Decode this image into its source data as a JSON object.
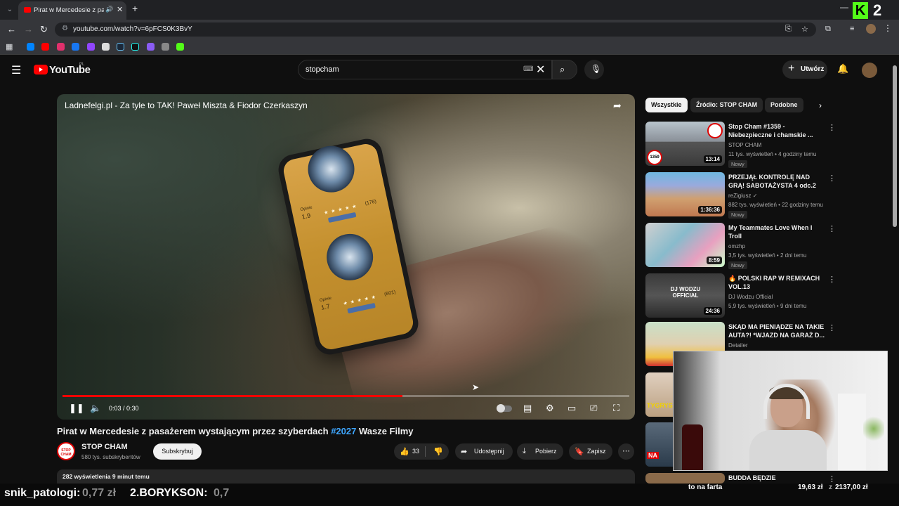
{
  "browser": {
    "tab_title": "Pirat w Mercedesie z pasaż",
    "url": "youtube.com/watch?v=6pFCS0K3BvY",
    "overlay_number": "2"
  },
  "youtube": {
    "logo_text": "YouTube",
    "country_code": "PL",
    "search_value": "stopcham",
    "create_label": "Utwórz"
  },
  "player": {
    "title": "Ladnefelgi.pl - Za tyle to TAK! Paweł Miszta & Fiodor Czerkaszyn",
    "time": "0:03 / 0:30",
    "progress": 0.6,
    "buffered": 0.6,
    "phone": {
      "rating_label": "Opinie",
      "rating_1": "1.9",
      "count_1": "(178)",
      "rating_2": "1.7",
      "count_2": "(601)",
      "stars": "★ ★ ★ ★ ★"
    }
  },
  "video": {
    "title_text": "Pirat w Mercedesie z pasażerem wystającym przez szyberdach ",
    "hashtag": "#2027",
    "title_suffix": " Wasze Filmy",
    "channel_name": "STOP CHAM",
    "channel_avatar_text": "STOP CHAM",
    "subscribers": "580 tys. subskrybentów",
    "subscribe_label": "Subskrybuj",
    "likes": "33",
    "share_label": "Udostępnij",
    "download_label": "Pobierz",
    "save_label": "Zapisz",
    "views_time": "282 wyświetlenia  9 minut temu"
  },
  "chips": [
    "Wszystkie",
    "Źródło: STOP CHAM",
    "Podobne"
  ],
  "recommendations": [
    {
      "title": "Stop Cham #1359 - Niebezpieczne i chamskie ...",
      "channel": "STOP CHAM",
      "meta": "11 tys. wyświetleń • 4 godziny temu",
      "badge": "Nowy",
      "duration": "13:14",
      "thumb_badge": "1359"
    },
    {
      "title": "PRZEJĄŁ KONTROLĘ NAD GRĄ! SABOTAŻYSTA 4 odc.2",
      "channel": "reZigiusz",
      "meta": "882 tys. wyświetleń • 22 godziny temu",
      "badge": "Nowy",
      "duration": "1:36:36"
    },
    {
      "title": "My Teammates Love When I Troll",
      "channel": "omzhp",
      "meta": "3,5 tys. wyświetleń • 2 dni temu",
      "badge": "Nowy",
      "duration": "8:59"
    },
    {
      "title": "POLSKI RAP W REMIXACH VOL.13",
      "channel": "DJ Wodzu Official",
      "meta": "5,9 tys. wyświetleń • 9 dni temu",
      "duration": "24:36",
      "thumb_text": "DJ WODZU OFFICIAL"
    },
    {
      "title": "SKĄD MA PIENIĄDZE NA TAKIE AUTA?! *WJAZD NA GARAŻ D...",
      "channel": "Detailer"
    },
    {
      "title": "",
      "thumb_text": "TYGRYS"
    },
    {
      "title": "",
      "thumb_text": "NA"
    },
    {
      "title": "BUDDA BĘDZIE DEPORTOWANY"
    }
  ],
  "stream_bar": {
    "item1_name": "snik_patologi:",
    "item1_value": "0,77 zł",
    "item2_name": "2.BORYKSON:",
    "item2_value": "0,7",
    "goal_label": "to na farta",
    "goal_current": "19,63 zł",
    "goal_separator": "z",
    "goal_target": "2137,00 zł"
  }
}
